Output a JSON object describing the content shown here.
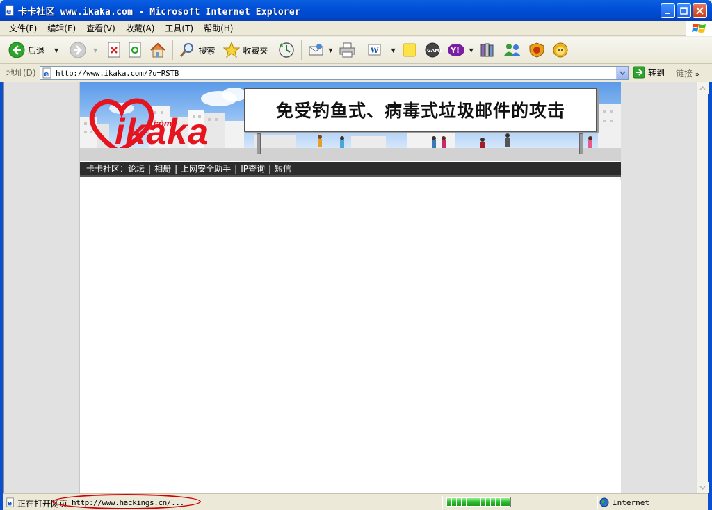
{
  "window": {
    "title": "卡卡社区 www.ikaka.com - Microsoft Internet Explorer"
  },
  "menu": [
    "文件(F)",
    "编辑(E)",
    "查看(V)",
    "收藏(A)",
    "工具(T)",
    "帮助(H)"
  ],
  "toolbar": {
    "back_label": "后退",
    "search_label": "搜索",
    "favorites_label": "收藏夹"
  },
  "address": {
    "label": "地址(D)",
    "value": "http://www.ikaka.com/?u=RSTB",
    "go_label": "转到",
    "links_label": "链接"
  },
  "page": {
    "logo_text": "ikaka",
    "logo_com": ".com",
    "billboard_text": "免受钓鱼式、病毒式垃圾邮件的攻击",
    "nav": [
      "卡卡社区：论坛",
      "相册",
      "上网安全助手",
      "IP查询",
      "短信"
    ]
  },
  "status": {
    "text": "正在打开网页",
    "url": "http://www.hackings.cn/...",
    "progress": 1.0,
    "zone": "Internet"
  },
  "colors": {
    "titlebar": "#0150d8",
    "logo_red": "#e5141e",
    "highlight_ellipse": "#d40000"
  }
}
